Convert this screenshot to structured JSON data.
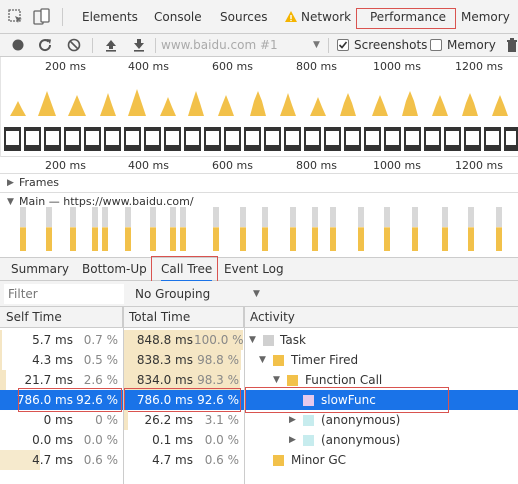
{
  "tabs": {
    "elements": "Elements",
    "console": "Console",
    "sources": "Sources",
    "network": "Network",
    "performance": "Performance",
    "memory": "Memory"
  },
  "toolbar": {
    "url_placeholder": "www.baidu.com #1",
    "screenshots_label": "Screenshots",
    "memory_label": "Memory",
    "screenshots_checked": true,
    "memory_checked": false
  },
  "ruler": {
    "top": [
      "200 ms",
      "400 ms",
      "600 ms",
      "800 ms",
      "1000 ms",
      "1200 ms"
    ],
    "bottom": [
      "200 ms",
      "400 ms",
      "600 ms",
      "800 ms",
      "1000 ms",
      "1200 ms"
    ]
  },
  "tracks": {
    "frames": "Frames",
    "main": "Main — https://www.baidu.com/"
  },
  "details_tabs": {
    "summary": "Summary",
    "bottom_up": "Bottom-Up",
    "call_tree": "Call Tree",
    "event_log": "Event Log"
  },
  "filter": {
    "placeholder": "Filter",
    "grouping": "No Grouping"
  },
  "table": {
    "headers": {
      "self_time": "Self Time",
      "total_time": "Total Time",
      "activity": "Activity"
    },
    "rows": [
      {
        "self_ms": "5.7 ms",
        "self_pct": "0.7 %",
        "total_ms": "848.8 ms",
        "total_pct": "100.0 %",
        "activity": "Task",
        "swatch": "#d0d0d0",
        "expand": "expanded"
      },
      {
        "self_ms": "4.3 ms",
        "self_pct": "0.5 %",
        "total_ms": "838.3 ms",
        "total_pct": "98.8 %",
        "activity": "Timer Fired",
        "swatch": "#f2c14a",
        "expand": "expanded"
      },
      {
        "self_ms": "21.7 ms",
        "self_pct": "2.6 %",
        "total_ms": "834.0 ms",
        "total_pct": "98.3 %",
        "activity": "Function Call",
        "swatch": "#f2c14a",
        "expand": "expanded"
      },
      {
        "self_ms": "786.0 ms",
        "self_pct": "92.6 %",
        "total_ms": "786.0 ms",
        "total_pct": "92.6 %",
        "activity": "slowFunc",
        "swatch": "#e6c9ec",
        "expand": "none"
      },
      {
        "self_ms": "0 ms",
        "self_pct": "0 %",
        "total_ms": "26.2 ms",
        "total_pct": "3.1 %",
        "activity": "(anonymous)",
        "swatch": "#c7ecee",
        "expand": "collapsed"
      },
      {
        "self_ms": "0.0 ms",
        "self_pct": "0.0 %",
        "total_ms": "0.1 ms",
        "total_pct": "0.0 %",
        "activity": "(anonymous)",
        "swatch": "#c7ecee",
        "expand": "collapsed"
      },
      {
        "self_ms": "4.7 ms",
        "self_pct": "0.6 %",
        "total_ms": "4.7 ms",
        "total_pct": "0.6 %",
        "activity": "Minor GC",
        "swatch": "#f2c14a",
        "expand": "none"
      }
    ]
  },
  "colors": {
    "accent": "#1a73e8",
    "highlight_box": "#d9534f",
    "scripting": "#f2c14a",
    "bar_bg": "#f5e6c4"
  }
}
